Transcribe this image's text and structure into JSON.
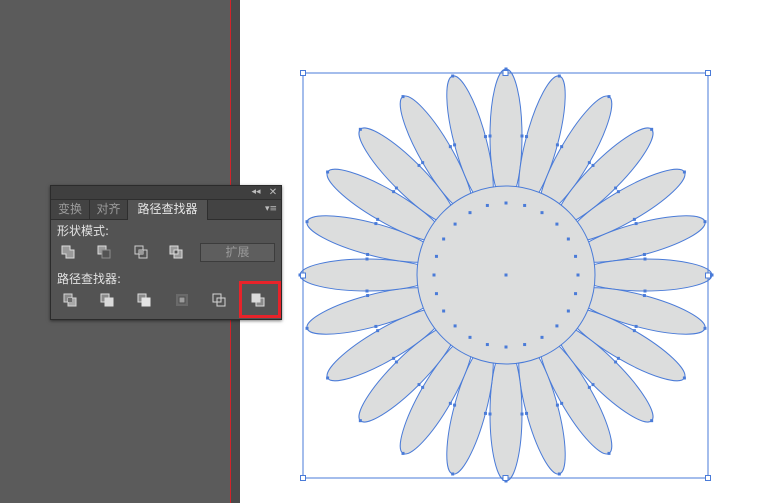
{
  "panel": {
    "tabs": [
      "变换",
      "对齐",
      "路径查找器"
    ],
    "active_tab": "路径查找器",
    "collapse_glyph": "◂◂",
    "close_glyph": "✕",
    "menu_glyph": "▾≡",
    "shape_modes_label": "形状模式:",
    "pathfinders_label": "路径查找器:",
    "expand_label": "扩展",
    "shape_mode_buttons": [
      "unite-icon",
      "minus-front-icon",
      "intersect-icon",
      "exclude-icon"
    ],
    "pathfinder_buttons": [
      "divide-icon",
      "trim-icon",
      "merge-icon",
      "crop-icon",
      "outline-icon",
      "minus-back-icon"
    ],
    "highlighted_button": "minus-back-icon",
    "highlight_color": "#e8232a"
  },
  "canvas": {
    "artboard_edge_color": "#d2232a",
    "selection_color": "#4a7bd8",
    "shape_fill": "#dcdddd",
    "petal_count": 24
  }
}
